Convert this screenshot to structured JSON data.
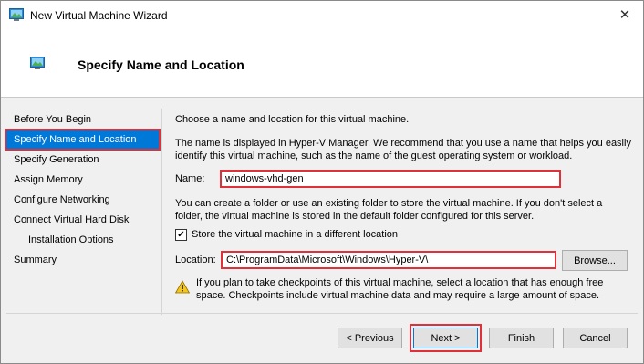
{
  "window": {
    "title": "New Virtual Machine Wizard",
    "close_glyph": "✕",
    "icon": "window-app-icon"
  },
  "header": {
    "title": "Specify Name and Location",
    "icon": "wizard-page-icon"
  },
  "nav": {
    "items": [
      {
        "label": "Before You Begin",
        "selected": false,
        "sub": false
      },
      {
        "label": "Specify Name and Location",
        "selected": true,
        "sub": false
      },
      {
        "label": "Specify Generation",
        "selected": false,
        "sub": false
      },
      {
        "label": "Assign Memory",
        "selected": false,
        "sub": false
      },
      {
        "label": "Configure Networking",
        "selected": false,
        "sub": false
      },
      {
        "label": "Connect Virtual Hard Disk",
        "selected": false,
        "sub": false
      },
      {
        "label": "Installation Options",
        "selected": false,
        "sub": true
      },
      {
        "label": "Summary",
        "selected": false,
        "sub": false
      }
    ]
  },
  "content": {
    "intro": "Choose a name and location for this virtual machine.",
    "name_desc_1": "The name is displayed in Hyper-V Manager. We recommend that you use a name that helps you easily",
    "name_desc_2": "identify this virtual machine, such as the name of the guest operating system or workload.",
    "name_label": "Name:",
    "name_value": "windows-vhd-gen",
    "folder_desc_1": "You can create a folder or use an existing folder to store the virtual machine. If you don't select a",
    "folder_desc_2": "folder, the virtual machine is stored in the default folder configured for this server.",
    "store_checkbox_label": "Store the virtual machine in a different location",
    "store_checked": true,
    "check_glyph": "✔",
    "location_label": "Location:",
    "location_value": "C:\\ProgramData\\Microsoft\\Windows\\Hyper-V\\",
    "browse_label": "Browse...",
    "warning_1": "If you plan to take checkpoints of this virtual machine, select a location that has enough free",
    "warning_2": "space. Checkpoints include virtual machine data and may require a large amount of space.",
    "warning_icon": "warning-icon"
  },
  "footer": {
    "previous_label": "< Previous",
    "next_label": "Next >",
    "finish_label": "Finish",
    "cancel_label": "Cancel"
  },
  "colors": {
    "selection": "#0078d7",
    "highlight": "#e0313a",
    "panel": "#f0f0f0"
  }
}
